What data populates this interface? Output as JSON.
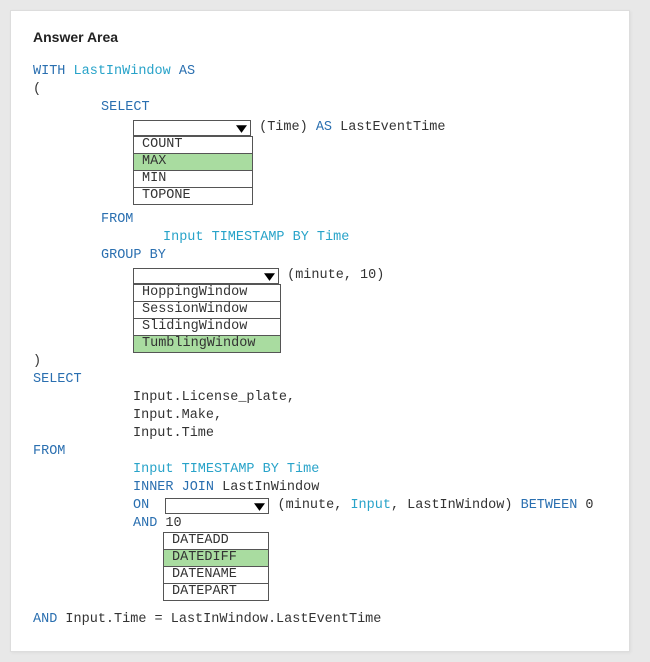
{
  "header": {
    "title": "Answer Area"
  },
  "sql": {
    "with": "WITH",
    "cte": "LastInWindow",
    "as": "AS",
    "open": "(",
    "close": ")",
    "select": "SELECT",
    "time_arg": "(Time)",
    "as2": "AS",
    "alias": "LastEventTime",
    "from": "FROM",
    "from_body": "Input TIMESTAMP BY Time",
    "groupby": "GROUP BY",
    "gb_args": "(minute, 10)",
    "select2": "SELECT",
    "s1": "Input.License_plate,",
    "s2": "Input.Make,",
    "s3": "Input.Time",
    "from2": "FROM",
    "from2_body": "Input TIMESTAMP BY Time",
    "inner_join": "INNER JOIN",
    "ij_target": "LastInWindow",
    "on": "ON",
    "on_args_pre": "(minute,",
    "on_args_in": "Input",
    "on_args_mid": ", LastInWindow)",
    "between": "BETWEEN",
    "zero": "0",
    "and": "AND",
    "ten": "10",
    "and2": "AND",
    "final": "Input.Time = LastInWindow.LastEventTime"
  },
  "dropdown1": {
    "options": [
      "COUNT",
      "MAX",
      "MIN",
      "TOPONE"
    ],
    "selected": "MAX"
  },
  "dropdown2": {
    "options": [
      "HoppingWindow",
      "SessionWindow",
      "SlidingWindow",
      "TumblingWindow"
    ],
    "selected": "TumblingWindow"
  },
  "dropdown3": {
    "options": [
      "DATEADD",
      "DATEDIFF",
      "DATENAME",
      "DATEPART"
    ],
    "selected": "DATEDIFF"
  }
}
